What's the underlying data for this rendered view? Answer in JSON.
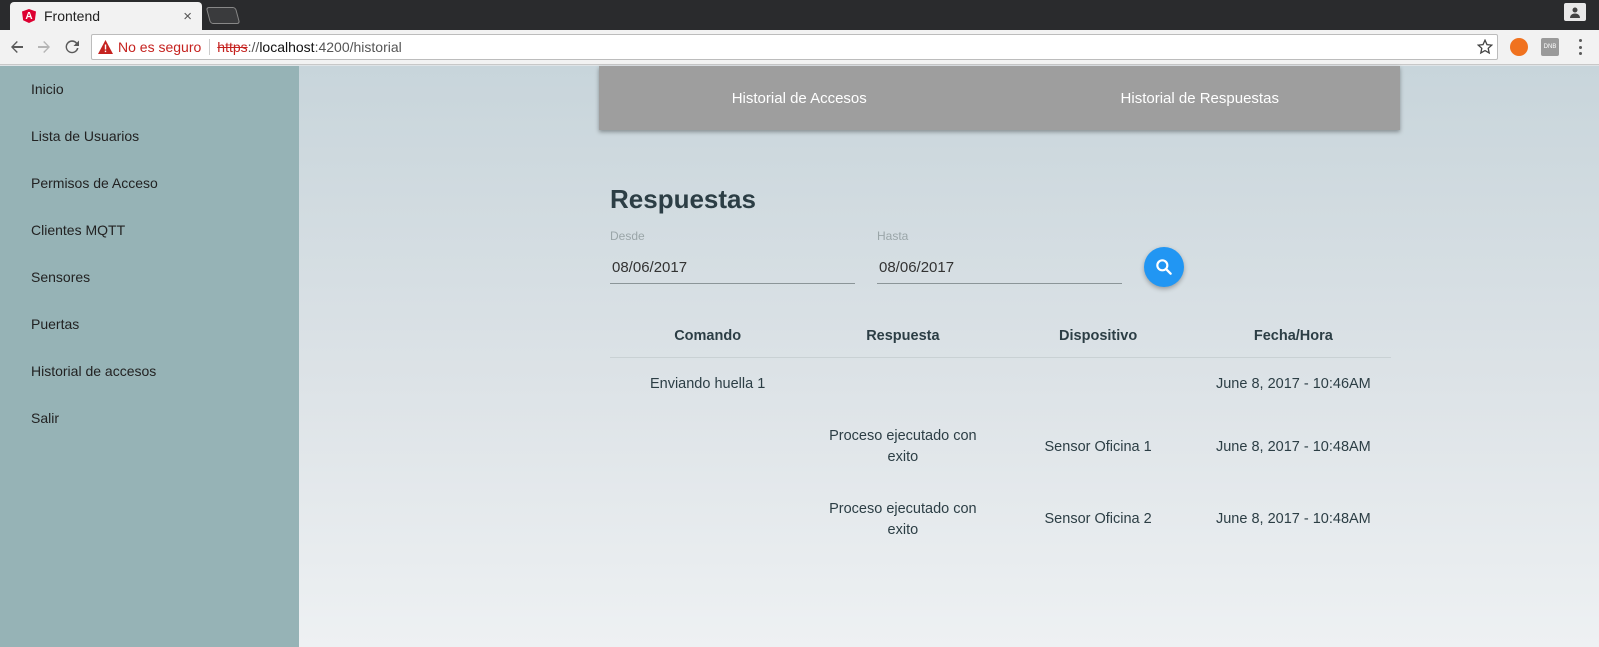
{
  "browser": {
    "tab_title": "Frontend",
    "tab_favicon": "A",
    "tab_close": "×",
    "security_label": "No es seguro",
    "url_scheme": "https",
    "url_sep": "://",
    "url_host": "localhost",
    "url_path": ":4200/historial",
    "ext_2_label": "DNB"
  },
  "sidebar": {
    "items": [
      {
        "label": "Inicio"
      },
      {
        "label": "Lista de Usuarios"
      },
      {
        "label": "Permisos de Acceso"
      },
      {
        "label": "Clientes MQTT"
      },
      {
        "label": "Sensores"
      },
      {
        "label": "Puertas"
      },
      {
        "label": "Historial de accesos"
      },
      {
        "label": "Salir"
      }
    ]
  },
  "tabs": {
    "accesos": "Historial de Accesos",
    "respuestas": "Historial de Respuestas"
  },
  "section": {
    "title": "Respuestas"
  },
  "filters": {
    "desde_label": "Desde",
    "desde_value": "08/06/2017",
    "hasta_label": "Hasta",
    "hasta_value": "08/06/2017"
  },
  "table": {
    "headers": [
      "Comando",
      "Respuesta",
      "Dispositivo",
      "Fecha/Hora"
    ],
    "rows": [
      [
        "Enviando huella 1",
        "",
        "",
        "June 8, 2017 - 10:46AM"
      ],
      [
        "",
        "Proceso ejecutado con exito",
        "Sensor Oficina 1",
        "June 8, 2017 - 10:48AM"
      ],
      [
        "",
        "Proceso ejecutado con exito",
        "Sensor Oficina 2",
        "June 8, 2017 - 10:48AM"
      ]
    ]
  },
  "colors": {
    "sidebar_bg": "#96b3b6",
    "tabs_bg": "#9e9e9e",
    "fab_bg": "#2196f3",
    "insecure_red": "#c5221f"
  },
  "icons": {
    "back": "arrow-left-icon",
    "forward": "arrow-right-icon",
    "reload": "reload-icon",
    "warning": "warning-icon",
    "bookmark": "star-icon",
    "search": "search-icon"
  }
}
